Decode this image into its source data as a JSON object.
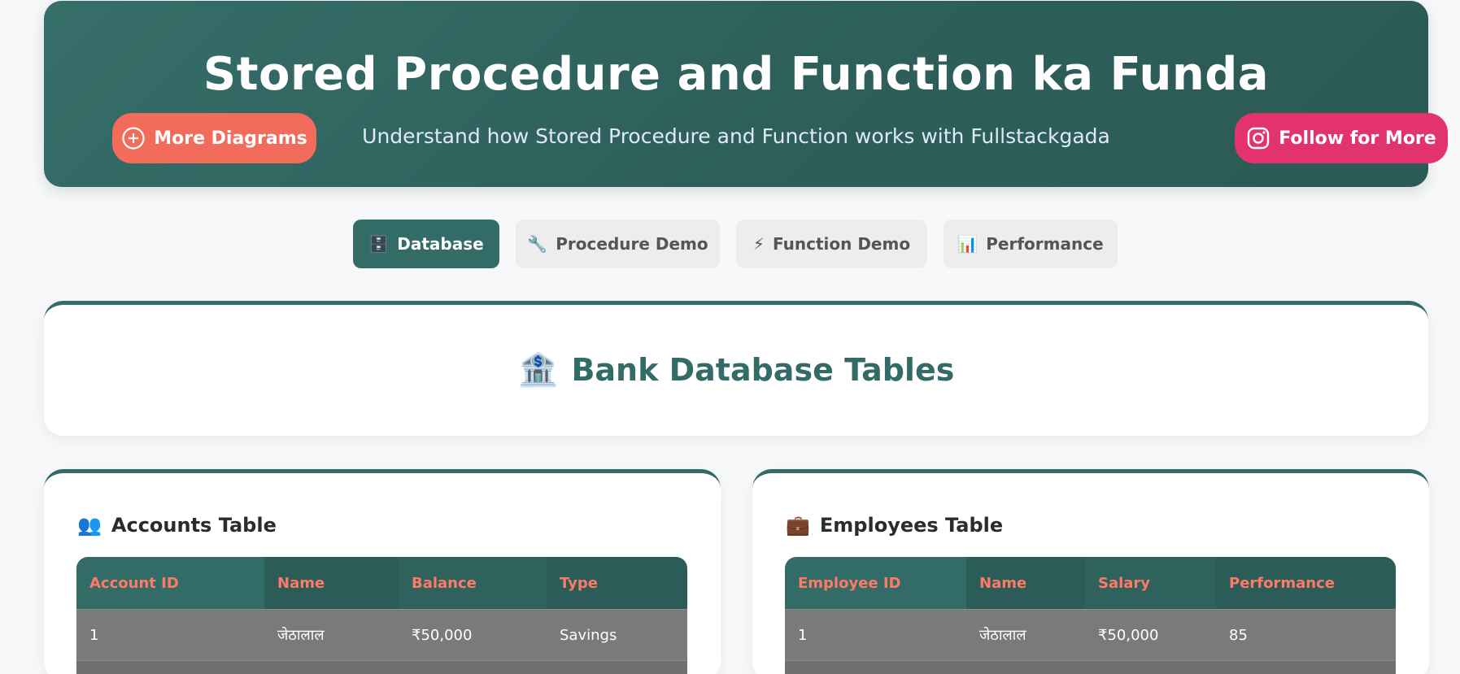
{
  "header": {
    "title": "Stored Procedure and Function ka Funda",
    "subtitle": "Understand how Stored Procedure and Function works with Fullstackgada",
    "more_button": "More Diagrams",
    "follow_button": "Follow for More",
    "colors": {
      "background": "#336b66",
      "more": "#f26b5b",
      "follow": "#e3336e"
    }
  },
  "tabs": [
    {
      "icon": "🗄️",
      "label": "Database",
      "active": true
    },
    {
      "icon": "🔧",
      "label": "Procedure Demo",
      "active": false
    },
    {
      "icon": "⚡",
      "label": "Function Demo",
      "active": false
    },
    {
      "icon": "📊",
      "label": "Performance",
      "active": false
    }
  ],
  "section": {
    "icon": "🏦",
    "title": "Bank Database Tables"
  },
  "accounts": {
    "icon": "👥",
    "title": "Accounts Table",
    "columns": [
      "Account ID",
      "Name",
      "Balance",
      "Type"
    ],
    "rows": [
      [
        "1",
        "जेठालाल",
        "₹50,000",
        "Savings"
      ]
    ]
  },
  "employees": {
    "icon": "💼",
    "title": "Employees Table",
    "columns": [
      "Employee ID",
      "Name",
      "Salary",
      "Performance"
    ],
    "rows": [
      [
        "1",
        "जेठालाल",
        "₹50,000",
        "85"
      ]
    ]
  }
}
